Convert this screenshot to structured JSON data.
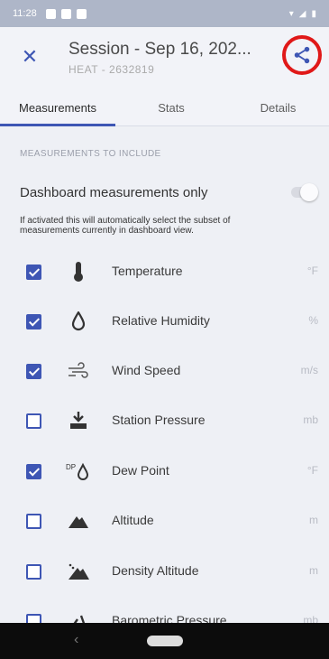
{
  "status": {
    "time": "11:28"
  },
  "header": {
    "title": "Session - Sep 16, 202...",
    "subtitle": "HEAT - 2632819"
  },
  "tabs": [
    {
      "label": "Measurements",
      "active": true
    },
    {
      "label": "Stats",
      "active": false
    },
    {
      "label": "Details",
      "active": false
    }
  ],
  "section_label": "MEASUREMENTS TO INCLUDE",
  "dashboard_toggle": {
    "label": "Dashboard measurements only",
    "description": "If activated this will automatically select the subset of measurements currently in dashboard view.",
    "on": false
  },
  "measurements": [
    {
      "label": "Temperature",
      "unit": "°F",
      "checked": true,
      "icon": "thermometer-icon"
    },
    {
      "label": "Relative Humidity",
      "unit": "%",
      "checked": true,
      "icon": "humidity-drop-icon"
    },
    {
      "label": "Wind Speed",
      "unit": "m/s",
      "checked": true,
      "icon": "wind-icon"
    },
    {
      "label": "Station Pressure",
      "unit": "mb",
      "checked": false,
      "icon": "pressure-icon"
    },
    {
      "label": "Dew Point",
      "unit": "°F",
      "checked": true,
      "icon": "dew-point-icon"
    },
    {
      "label": "Altitude",
      "unit": "m",
      "checked": false,
      "icon": "mountain-icon"
    },
    {
      "label": "Density Altitude",
      "unit": "m",
      "checked": false,
      "icon": "density-altitude-icon"
    },
    {
      "label": "Barometric Pressure",
      "unit": "mb",
      "checked": false,
      "icon": "barometer-icon"
    }
  ]
}
